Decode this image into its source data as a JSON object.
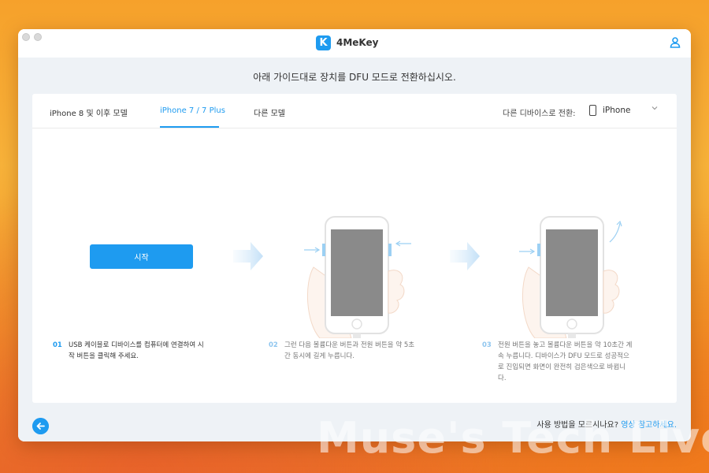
{
  "app": {
    "title": "4MeKey",
    "logo_letter": "K"
  },
  "page": {
    "instruction": "아래 가이드대로 장치를 DFU 모드로 전환하십시오."
  },
  "tabs": [
    {
      "label": "iPhone 8 및 이후 모델",
      "active": false
    },
    {
      "label": "iPhone 7 / 7 Plus",
      "active": true
    },
    {
      "label": "다른 모델",
      "active": false
    }
  ],
  "device_switch": {
    "label": "다른 디바이스로 전환:",
    "value": "iPhone"
  },
  "start_button": {
    "label": "시작"
  },
  "steps": [
    {
      "number": "01",
      "text_line1": "USB 케이블로 디바이스를 컴퓨터에 연결하여 시",
      "text_line2": "작 버튼을 클릭해 주세요."
    },
    {
      "number": "02",
      "text_line1": "그런 다음 볼륨다운 버튼과 전원 버튼을 약 5초",
      "text_line2": "간 동시에 길게 누릅니다."
    },
    {
      "number": "03",
      "text_line1": "전원 버튼을 놓고 볼륨다운 버튼을 약 10초간 계",
      "text_line2": "속 누릅니다. 디바이스가 DFU 모드로 성공적으",
      "text_line3": "로 진입되면 화면이 완전히 검은색으로 바뀝니",
      "text_line4": "다."
    }
  ],
  "footer": {
    "question": "사용 방법을 모르시나요?",
    "link": "영상 참고하세요."
  },
  "watermark": "Muse's Tech Live",
  "colors": {
    "accent": "#1e9bf0",
    "content_bg": "#eef2f6",
    "phone_screen": "#8a8a8a"
  },
  "icons": [
    "user-icon",
    "phone-icon",
    "chevron-down-icon",
    "back-arrow-icon"
  ]
}
